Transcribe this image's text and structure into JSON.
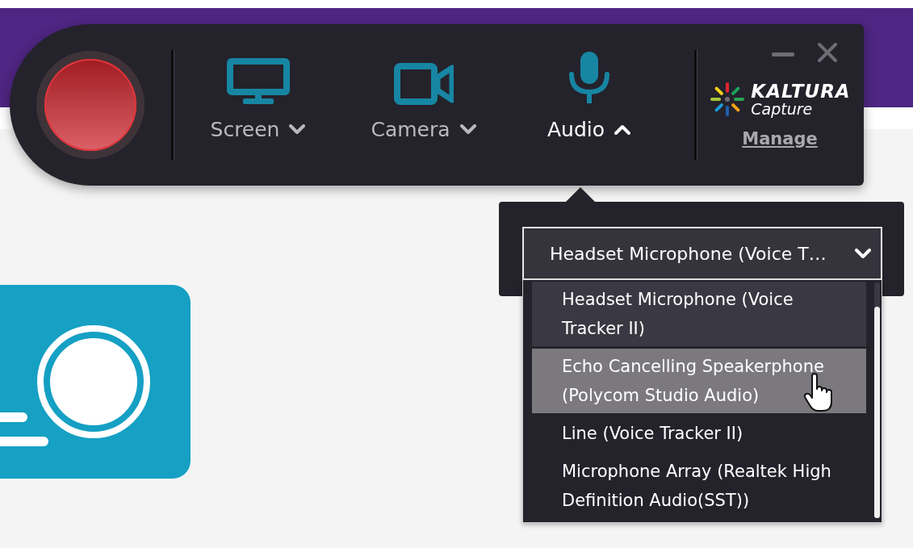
{
  "recorder": {
    "sources": [
      {
        "kind": "screen",
        "label": "Screen",
        "expanded": false
      },
      {
        "kind": "camera",
        "label": "Camera",
        "expanded": false
      },
      {
        "kind": "audio",
        "label": "Audio",
        "expanded": true
      }
    ],
    "logo": {
      "name": "KALTURA",
      "product": "Capture"
    },
    "manage_link": "Manage"
  },
  "audio_menu": {
    "value": "Headset Microphone (Voice T…",
    "options": [
      {
        "label": "Headset Microphone (Voice Tracker II)",
        "selected": true,
        "hovered": false
      },
      {
        "label": "Echo Cancelling Speakerphone (Polycom Studio Audio)",
        "selected": false,
        "hovered": true
      },
      {
        "label": "Line (Voice Tracker II)",
        "selected": false,
        "hovered": false
      },
      {
        "label": "Microphone Array (Realtek High Definition Audio(SST))",
        "selected": false,
        "hovered": false
      }
    ]
  }
}
